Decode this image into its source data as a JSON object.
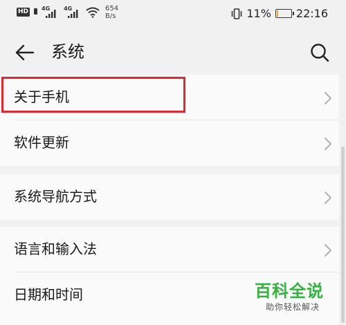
{
  "status_bar": {
    "hd": "HD",
    "network1": "4G",
    "network2": "4G",
    "speed_value": "654",
    "speed_unit": "B/s",
    "battery": "11%",
    "battery_level": 0.11,
    "time": "22:16"
  },
  "header": {
    "title": "系统"
  },
  "groups": [
    {
      "items": [
        {
          "label": "关于手机"
        },
        {
          "label": "软件更新"
        }
      ]
    },
    {
      "items": [
        {
          "label": "系统导航方式"
        }
      ]
    },
    {
      "items": [
        {
          "label": "语言和输入法"
        },
        {
          "label": "日期和时间"
        }
      ]
    }
  ],
  "watermark": {
    "title": "百科全说",
    "subtitle": "助你轻松解决"
  },
  "colors": {
    "highlight": "#e3262f",
    "brand_green": "#2db53c",
    "battery_fill": "#f0a81d"
  }
}
